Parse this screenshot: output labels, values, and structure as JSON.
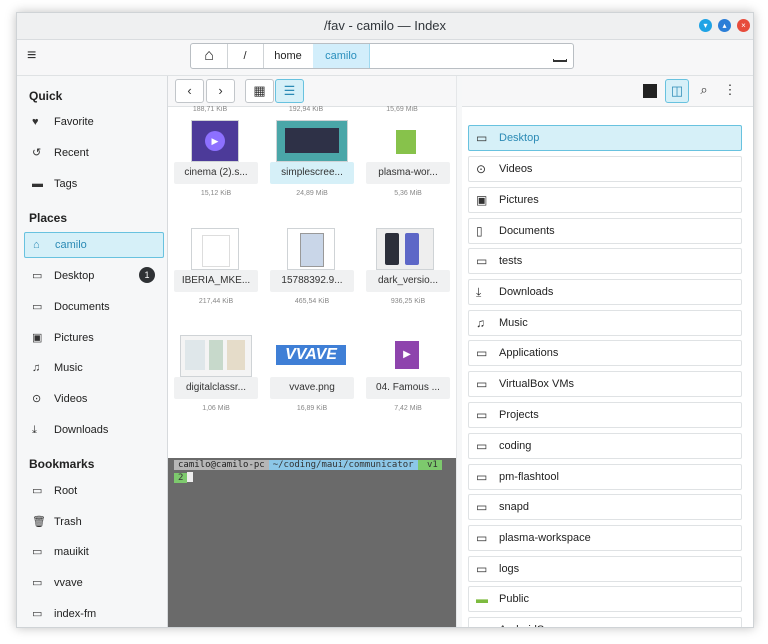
{
  "window": {
    "title": "/fav - camilo — Index",
    "controls": [
      "minimize",
      "maximize",
      "close"
    ],
    "colors": {
      "minimize": "#1fa3e5",
      "maximize": "#2b7ed7",
      "close": "#e74c3c"
    }
  },
  "toolbar": {
    "menu_icon": "hamburger-icon",
    "breadcrumb": {
      "home_icon": "home-icon",
      "root": "/",
      "items": [
        "home",
        "camilo"
      ],
      "active": "camilo"
    }
  },
  "sidebar": {
    "sections": {
      "quick": "Quick",
      "places": "Places",
      "bookmarks": "Bookmarks"
    },
    "quick": [
      {
        "label": "Favorite",
        "icon": "heart-icon"
      },
      {
        "label": "Recent",
        "icon": "clock-icon"
      },
      {
        "label": "Tags",
        "icon": "tag-icon"
      }
    ],
    "places": [
      {
        "label": "camilo",
        "icon": "home-icon",
        "active": true
      },
      {
        "label": "Desktop",
        "icon": "desktop-icon",
        "badge": "1"
      },
      {
        "label": "Documents",
        "icon": "folder-icon"
      },
      {
        "label": "Pictures",
        "icon": "pictures-icon"
      },
      {
        "label": "Music",
        "icon": "music-icon"
      },
      {
        "label": "Videos",
        "icon": "videos-icon"
      },
      {
        "label": "Downloads",
        "icon": "download-icon"
      }
    ],
    "bookmarks": [
      {
        "label": "Root",
        "icon": "folder-icon"
      },
      {
        "label": "Trash",
        "icon": "trash-icon"
      },
      {
        "label": "mauikit",
        "icon": "folder-icon"
      },
      {
        "label": "vvave",
        "icon": "folder-icon"
      },
      {
        "label": "index-fm",
        "icon": "folder-icon"
      }
    ]
  },
  "middle": {
    "toolbar": {
      "back": "‹",
      "forward": "›",
      "grid_icon": "grid-view-icon",
      "list_icon": "list-view-icon"
    },
    "top_sizes": [
      "188,71 KiB",
      "192,94 KiB",
      "15,69 MiB"
    ],
    "files": [
      {
        "name": "cinema (2).s...",
        "size": "15,12 KiB",
        "thumb": "video-purple"
      },
      {
        "name": "simplescree...",
        "size": "24,89 MiB",
        "thumb": "video-screen"
      },
      {
        "name": "plasma-wor...",
        "size": "5,36 MiB",
        "thumb": "zip"
      },
      {
        "name": "IBERIA_MKE...",
        "size": "217,44 KiB",
        "thumb": "document"
      },
      {
        "name": "15788392.9...",
        "size": "465,54 KiB",
        "thumb": "document"
      },
      {
        "name": "dark_versio...",
        "size": "936,25 KiB",
        "thumb": "phones"
      },
      {
        "name": "digitalclassr...",
        "size": "1,06 MiB",
        "thumb": "collage"
      },
      {
        "name": "vvave.png",
        "size": "16,89 KiB",
        "thumb": "vvave"
      },
      {
        "name": "04. Famous ...",
        "size": "7,42 MiB",
        "thumb": "audio"
      }
    ],
    "terminal": {
      "user": "camilo@camilo-pc",
      "path": "~/coding/maui/communicator",
      "git": " v1",
      "line2": "2"
    }
  },
  "right": {
    "toolbar": {
      "terminal_icon": "terminal-icon",
      "split_icon": "split-view-icon",
      "search_icon": "search-icon",
      "more_icon": "more-icon"
    },
    "items": [
      {
        "label": "Desktop",
        "icon": "desktop-icon",
        "active": true
      },
      {
        "label": "Videos",
        "icon": "videos-icon"
      },
      {
        "label": "Pictures",
        "icon": "pictures-icon"
      },
      {
        "label": "Documents",
        "icon": "document-icon"
      },
      {
        "label": "tests",
        "icon": "folder-icon"
      },
      {
        "label": "Downloads",
        "icon": "download-icon"
      },
      {
        "label": "Music",
        "icon": "music-icon"
      },
      {
        "label": "Applications",
        "icon": "folder-icon"
      },
      {
        "label": "VirtualBox VMs",
        "icon": "folder-icon"
      },
      {
        "label": "Projects",
        "icon": "folder-icon"
      },
      {
        "label": "coding",
        "icon": "folder-icon"
      },
      {
        "label": "pm-flashtool",
        "icon": "folder-icon"
      },
      {
        "label": "snapd",
        "icon": "folder-icon"
      },
      {
        "label": "plasma-workspace",
        "icon": "folder-icon"
      },
      {
        "label": "logs",
        "icon": "folder-icon"
      },
      {
        "label": "Public",
        "icon": "folder-green-icon"
      },
      {
        "label": "AndroidSpace",
        "icon": "folder-icon"
      }
    ]
  }
}
